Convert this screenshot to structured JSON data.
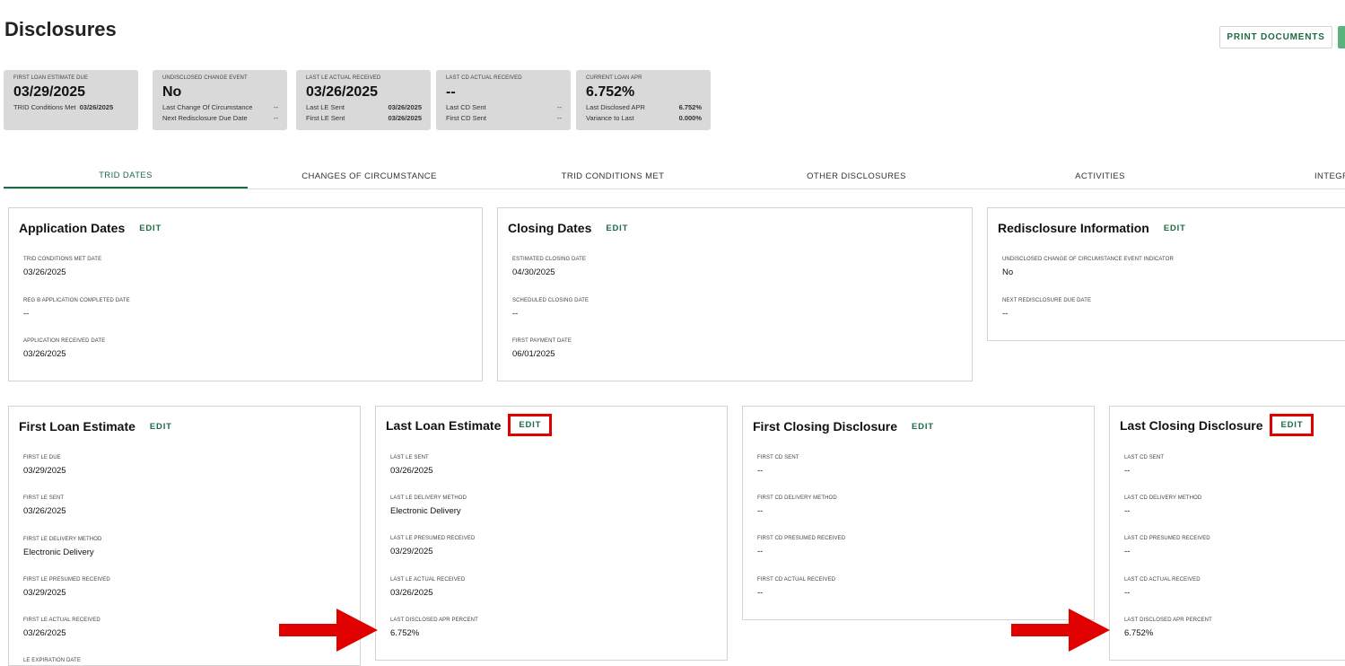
{
  "page": {
    "title": "Disclosures",
    "print_label": "PRINT DOCUMENTS"
  },
  "summary": [
    {
      "label": "FIRST LOAN ESTIMATE DUE",
      "value": "03/29/2025",
      "rows": [
        {
          "k": "TRID Conditions Met",
          "v": "03/26/2025"
        }
      ]
    },
    {
      "label": "UNDISCLOSED CHANGE EVENT",
      "value": "No",
      "rows": [
        {
          "k": "Last Change Of Circumstance",
          "v": "--"
        },
        {
          "k": "Next Redisclosure Due Date",
          "v": "--"
        }
      ]
    },
    {
      "label": "LAST LE ACTUAL RECEIVED",
      "value": "03/26/2025",
      "rows": [
        {
          "k": "Last LE Sent",
          "v": "03/26/2025"
        },
        {
          "k": "First LE Sent",
          "v": "03/26/2025"
        }
      ]
    },
    {
      "label": "LAST CD ACTUAL RECEIVED",
      "value": "--",
      "rows": [
        {
          "k": "Last CD Sent",
          "v": "--"
        },
        {
          "k": "First CD Sent",
          "v": "--"
        }
      ]
    },
    {
      "label": "CURRENT LOAN APR",
      "value": "6.752%",
      "rows": [
        {
          "k": "Last Disclosed APR",
          "v": "6.752%"
        },
        {
          "k": "Variance to Last",
          "v": "0.000%"
        }
      ]
    }
  ],
  "tabs": [
    "TRID DATES",
    "CHANGES OF CIRCUMSTANCE",
    "TRID CONDITIONS MET",
    "OTHER DISCLOSURES",
    "ACTIVITIES",
    "INTEGRA"
  ],
  "edit_label": "EDIT",
  "application_dates": {
    "title": "Application Dates",
    "fields": [
      {
        "label": "TRID CONDITIONS MET DATE",
        "value": "03/26/2025"
      },
      {
        "label": "REG B APPLICATION COMPLETED DATE",
        "value": "--"
      },
      {
        "label": "APPLICATION RECEIVED DATE",
        "value": "03/26/2025"
      }
    ]
  },
  "closing_dates": {
    "title": "Closing Dates",
    "fields": [
      {
        "label": "ESTIMATED CLOSING DATE",
        "value": "04/30/2025"
      },
      {
        "label": "SCHEDULED CLOSING DATE",
        "value": "--"
      },
      {
        "label": "FIRST PAYMENT DATE",
        "value": "06/01/2025"
      }
    ]
  },
  "redisclosure": {
    "title": "Redisclosure Information",
    "fields": [
      {
        "label": "UNDISCLOSED CHANGE OF CIRCUMSTANCE EVENT INDICATOR",
        "value": "No"
      },
      {
        "label": "NEXT REDISCLOSURE DUE DATE",
        "value": "--"
      }
    ]
  },
  "first_le": {
    "title": "First Loan Estimate",
    "fields": [
      {
        "label": "FIRST LE DUE",
        "value": "03/29/2025"
      },
      {
        "label": "FIRST LE SENT",
        "value": "03/26/2025"
      },
      {
        "label": "FIRST LE DELIVERY METHOD",
        "value": "Electronic Delivery"
      },
      {
        "label": "FIRST LE PRESUMED RECEIVED",
        "value": "03/29/2025"
      },
      {
        "label": "FIRST LE ACTUAL RECEIVED",
        "value": "03/26/2025"
      },
      {
        "label": "LE EXPIRATION DATE",
        "value": ""
      }
    ]
  },
  "last_le": {
    "title": "Last Loan Estimate",
    "fields": [
      {
        "label": "LAST LE SENT",
        "value": "03/26/2025"
      },
      {
        "label": "LAST LE DELIVERY METHOD",
        "value": "Electronic Delivery"
      },
      {
        "label": "LAST LE PRESUMED RECEIVED",
        "value": "03/29/2025"
      },
      {
        "label": "LAST LE ACTUAL RECEIVED",
        "value": "03/26/2025"
      },
      {
        "label": "LAST DISCLOSED APR PERCENT",
        "value": "6.752%"
      }
    ]
  },
  "first_cd": {
    "title": "First Closing Disclosure",
    "fields": [
      {
        "label": "FIRST CD SENT",
        "value": "--"
      },
      {
        "label": "FIRST CD DELIVERY METHOD",
        "value": "--"
      },
      {
        "label": "FIRST CD PRESUMED RECEIVED",
        "value": "--"
      },
      {
        "label": "FIRST CD ACTUAL RECEIVED",
        "value": "--"
      }
    ]
  },
  "last_cd": {
    "title": "Last Closing Disclosure",
    "fields": [
      {
        "label": "LAST CD SENT",
        "value": "--"
      },
      {
        "label": "LAST CD DELIVERY METHOD",
        "value": "--"
      },
      {
        "label": "LAST CD PRESUMED RECEIVED",
        "value": "--"
      },
      {
        "label": "LAST CD ACTUAL RECEIVED",
        "value": "--"
      },
      {
        "label": "LAST DISCLOSED APR PERCENT",
        "value": "6.752%"
      }
    ]
  },
  "colors": {
    "accent": "#1d6b45",
    "highlight": "#e00000",
    "summary_bg": "#d9d9d9"
  }
}
